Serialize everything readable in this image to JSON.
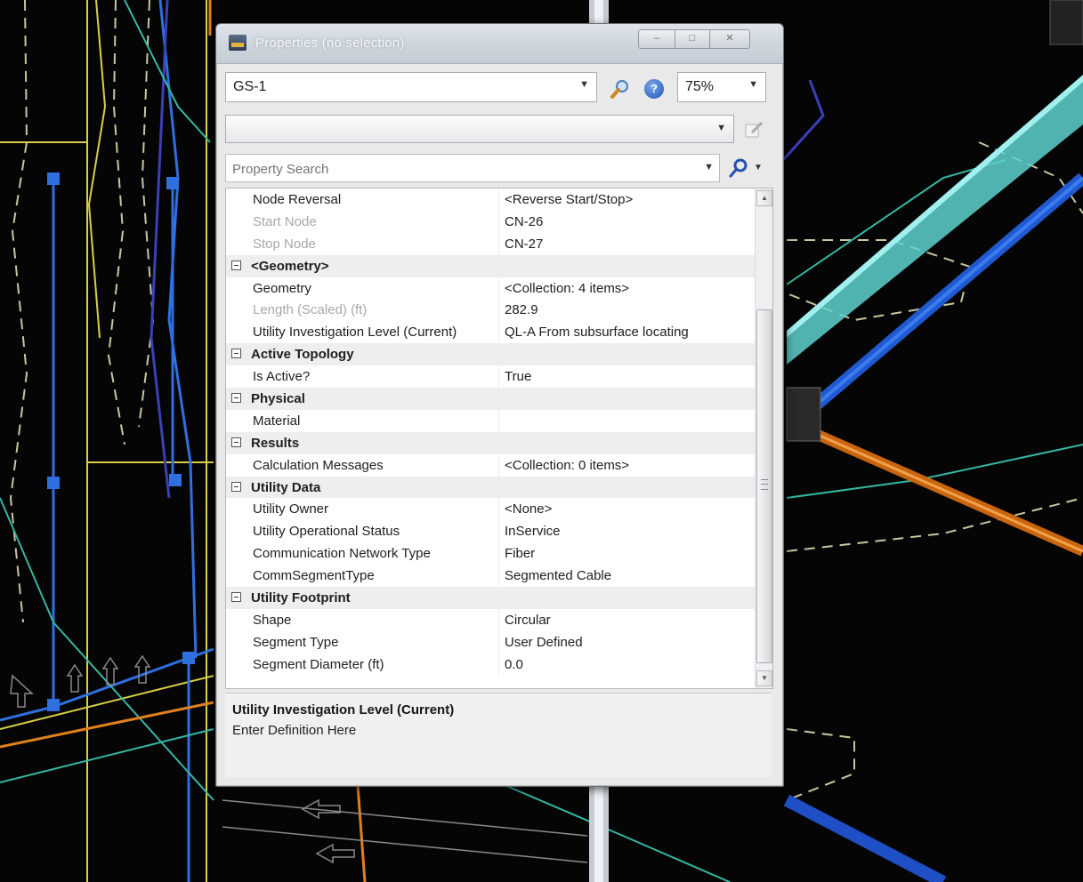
{
  "window": {
    "title": "Properties (no selection)"
  },
  "toolbar": {
    "element_select_value": "GS-1",
    "zoom_value": "75%"
  },
  "search": {
    "placeholder": "Property Search"
  },
  "grid": {
    "rows": [
      {
        "name": "Node Reversal",
        "value": "<Reverse Start/Stop>"
      },
      {
        "name": "Start Node",
        "value": "CN-26",
        "disabled": true
      },
      {
        "name": "Stop Node",
        "value": "CN-27",
        "disabled": true
      },
      {
        "category": "<Geometry>"
      },
      {
        "name": "Geometry",
        "value": "<Collection: 4 items>"
      },
      {
        "name": "Length (Scaled) (ft)",
        "value": "282.9",
        "disabled": true
      },
      {
        "name": "Utility Investigation Level (Current)",
        "value": "QL-A From subsurface locating"
      },
      {
        "category": "Active Topology"
      },
      {
        "name": "Is Active?",
        "value": "True"
      },
      {
        "category": "Physical"
      },
      {
        "name": "Material",
        "value": ""
      },
      {
        "category": "Results"
      },
      {
        "name": "Calculation Messages",
        "value": "<Collection: 0 items>"
      },
      {
        "category": "Utility Data"
      },
      {
        "name": "Utility Owner",
        "value": "<None>"
      },
      {
        "name": "Utility Operational Status",
        "value": "InService"
      },
      {
        "name": "Communication Network Type",
        "value": "Fiber"
      },
      {
        "name": "CommSegmentType",
        "value": "Segmented Cable"
      },
      {
        "category": "Utility Footprint"
      },
      {
        "name": "Shape",
        "value": "Circular"
      },
      {
        "name": "Segment Type",
        "value": "User Defined"
      },
      {
        "name": "Segment Diameter (ft)",
        "value": "0.0"
      }
    ]
  },
  "description": {
    "title": "Utility Investigation Level (Current)",
    "text": "Enter Definition Here"
  },
  "colors": {
    "background": "#050505",
    "cad_blue": "#2f6fe0",
    "cad_yellow": "#e6d84a",
    "cad_teal": "#35b7a3",
    "cad_orange": "#e0801c",
    "conduit": "#5fd2cf"
  },
  "icons": {
    "app": "app-icon",
    "zoom": "magnifier-icon",
    "help": "help-icon",
    "edit": "edit-icon",
    "search": "search-icon"
  }
}
